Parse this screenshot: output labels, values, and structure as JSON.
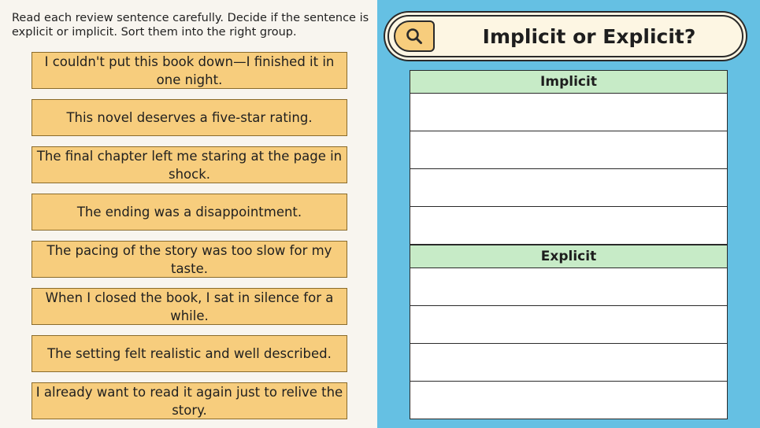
{
  "instructions": "Read each review sentence carefully. Decide if the sentence is explicit or implicit. Sort them into the right group.",
  "cards": [
    "I couldn't put this book down—I finished it in one night.",
    "This novel deserves a five-star rating.",
    "The final chapter left me staring at the page in shock.",
    "The ending was a disappointment.",
    "The pacing of the story was too slow for my taste.",
    "When I closed the book, I sat in silence for a while.",
    "The setting felt realistic and well described.",
    "I already want to read it again just to relive the story."
  ],
  "title": "Implicit or Explicit?",
  "title_icon": "search-icon",
  "groups": [
    {
      "label": "Implicit",
      "slots": 4
    },
    {
      "label": "Explicit",
      "slots": 4
    }
  ],
  "colors": {
    "left_bg": "#f8f5ef",
    "right_bg": "#65c0e3",
    "card_bg": "#f7cd7d",
    "header_bg": "#c7ebc7"
  }
}
